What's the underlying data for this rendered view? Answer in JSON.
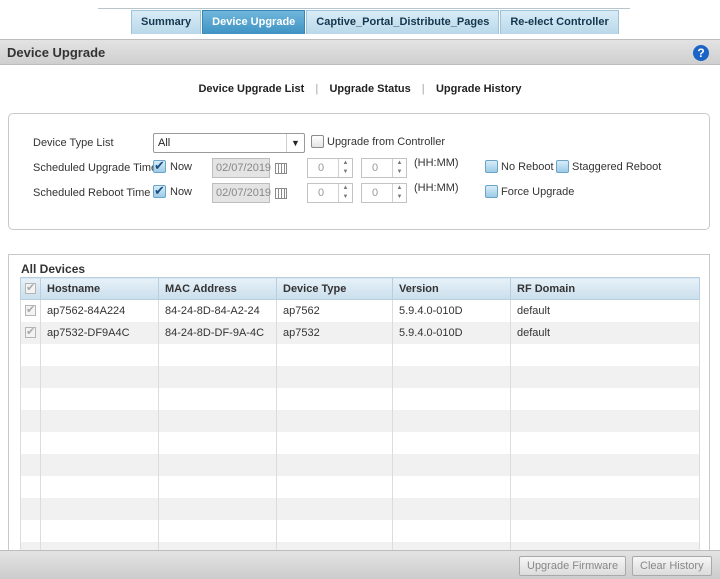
{
  "tabs": [
    {
      "label": "Summary"
    },
    {
      "label": "Device Upgrade"
    },
    {
      "label": "Captive_Portal_Distribute_Pages"
    },
    {
      "label": "Re-elect Controller"
    }
  ],
  "header": {
    "title": "Device Upgrade",
    "help": "?"
  },
  "sublinks": [
    "Device Upgrade List",
    "Upgrade Status",
    "Upgrade History"
  ],
  "settings": {
    "device_type_label": "Device Type List",
    "device_type_value": "All",
    "upgrade_from_controller": "Upgrade from Controller",
    "scheduled_upgrade_label": "Scheduled Upgrade Time",
    "scheduled_reboot_label": "Scheduled Reboot Time",
    "now": "Now",
    "upgrade_date": "02/07/2019",
    "reboot_date": "02/07/2019",
    "hour": "0",
    "minute": "0",
    "hhmm": "(HH:MM)",
    "no_reboot": "No Reboot",
    "staggered_reboot": "Staggered Reboot",
    "force_upgrade": "Force Upgrade"
  },
  "devices": {
    "title": "All Devices",
    "columns": [
      "Hostname",
      "MAC Address",
      "Device Type",
      "Version",
      "RF Domain"
    ],
    "rows": [
      {
        "hostname": "ap7562-84A224",
        "mac": "84-24-8D-84-A2-24",
        "type": "ap7562",
        "version": "5.9.4.0-010D",
        "domain": "default"
      },
      {
        "hostname": "ap7532-DF9A4C",
        "mac": "84-24-8D-DF-9A-4C",
        "type": "ap7532",
        "version": "5.9.4.0-010D",
        "domain": "default"
      }
    ]
  },
  "footer": {
    "upgrade_firmware": "Upgrade Firmware",
    "clear_history": "Clear History"
  }
}
